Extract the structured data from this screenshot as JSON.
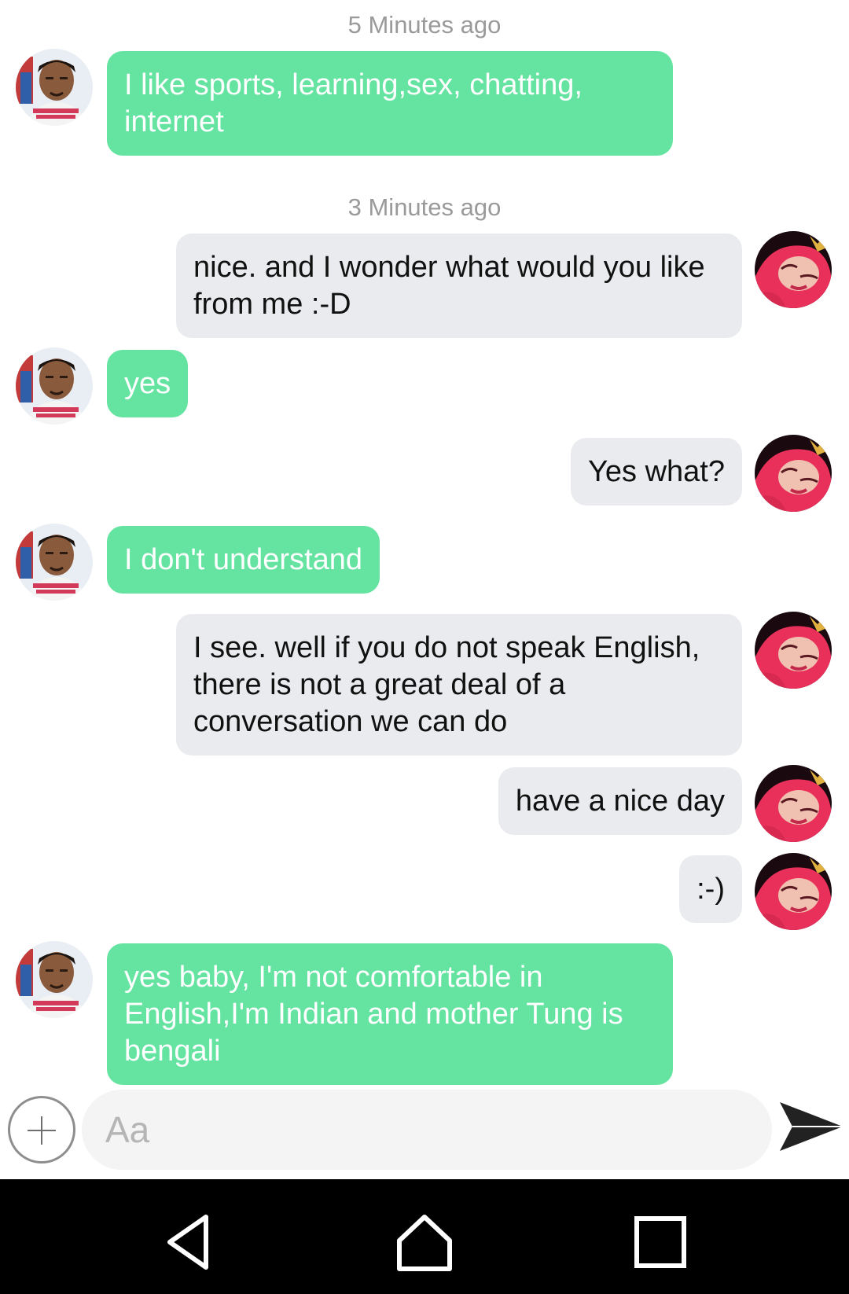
{
  "conversation": {
    "timestamps": [
      "5 Minutes ago",
      "3 Minutes ago"
    ],
    "messages": [
      {
        "sender": "them",
        "text": "I like sports, learning,sex, chatting, internet"
      },
      {
        "sender": "me",
        "text": "nice. and I wonder what would you like from me :-D"
      },
      {
        "sender": "them",
        "text": "yes"
      },
      {
        "sender": "me",
        "text": "Yes what?"
      },
      {
        "sender": "them",
        "text": "I don't understand"
      },
      {
        "sender": "me",
        "text": "I see.  well if you do not speak English, there is not a great deal of a conversation we can do"
      },
      {
        "sender": "me",
        "text": "have a nice day"
      },
      {
        "sender": "me",
        "text": ":-)"
      },
      {
        "sender": "them",
        "text": "yes baby, I'm not comfortable in English,I'm Indian and mother Tung is bengali"
      }
    ]
  },
  "composer": {
    "placeholder": "Aa",
    "add_icon": "plus-circle-icon",
    "send_icon": "send-arrow-icon"
  },
  "nav": {
    "back_icon": "back-triangle-icon",
    "home_icon": "home-icon",
    "recents_icon": "recents-square-icon"
  },
  "colors": {
    "incoming_bubble": "#64e3a1",
    "outgoing_bubble": "#e9ebee",
    "timestamp": "#9a9a9a",
    "nav_background": "#000000"
  }
}
